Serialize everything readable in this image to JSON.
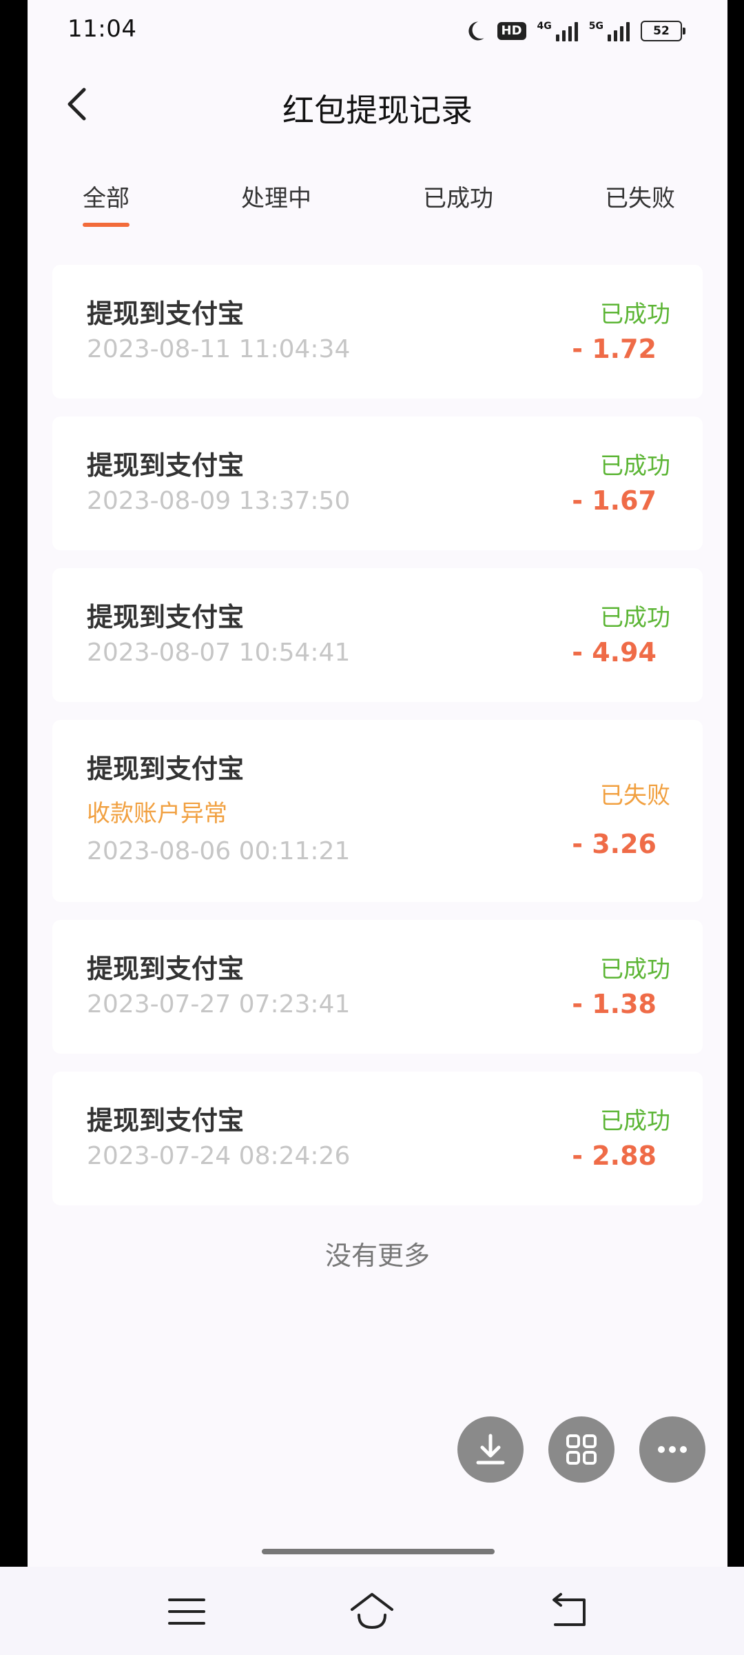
{
  "status_bar": {
    "time": "11:04",
    "network_badge": "HD",
    "signal1_label": "4G",
    "signal2_label": "5G",
    "battery": "52"
  },
  "header": {
    "title": "红包提现记录",
    "back_icon": "chevron-left-icon"
  },
  "tabs": [
    {
      "label": "全部",
      "active": true
    },
    {
      "label": "处理中",
      "active": false
    },
    {
      "label": "已成功",
      "active": false
    },
    {
      "label": "已失败",
      "active": false
    }
  ],
  "records": [
    {
      "title": "提现到支付宝",
      "date": "2023-08-11 11:04:34",
      "status": "已成功",
      "amount": "- 1.72"
    },
    {
      "title": "提现到支付宝",
      "date": "2023-08-09 13:37:50",
      "status": "已成功",
      "amount": "- 1.67"
    },
    {
      "title": "提现到支付宝",
      "date": "2023-08-07 10:54:41",
      "status": "已成功",
      "amount": "- 4.94"
    },
    {
      "title": "提现到支付宝",
      "note": "收款账户异常",
      "date": "2023-08-06 00:11:21",
      "status": "已失败",
      "amount": "- 3.26"
    },
    {
      "title": "提现到支付宝",
      "date": "2023-07-27 07:23:41",
      "status": "已成功",
      "amount": "- 1.38"
    },
    {
      "title": "提现到支付宝",
      "date": "2023-07-24 08:24:26",
      "status": "已成功",
      "amount": "- 2.88"
    }
  ],
  "footer_text": "没有更多",
  "floating_buttons": [
    "download-icon",
    "apps-grid-icon",
    "more-dots-icon"
  ],
  "nav_buttons": [
    "menu-icon",
    "home-icon",
    "back-icon"
  ],
  "colors": {
    "accent": "#f26b3a",
    "success": "#5cb535",
    "failure": "#f1a040",
    "amount": "#ef6b47"
  }
}
